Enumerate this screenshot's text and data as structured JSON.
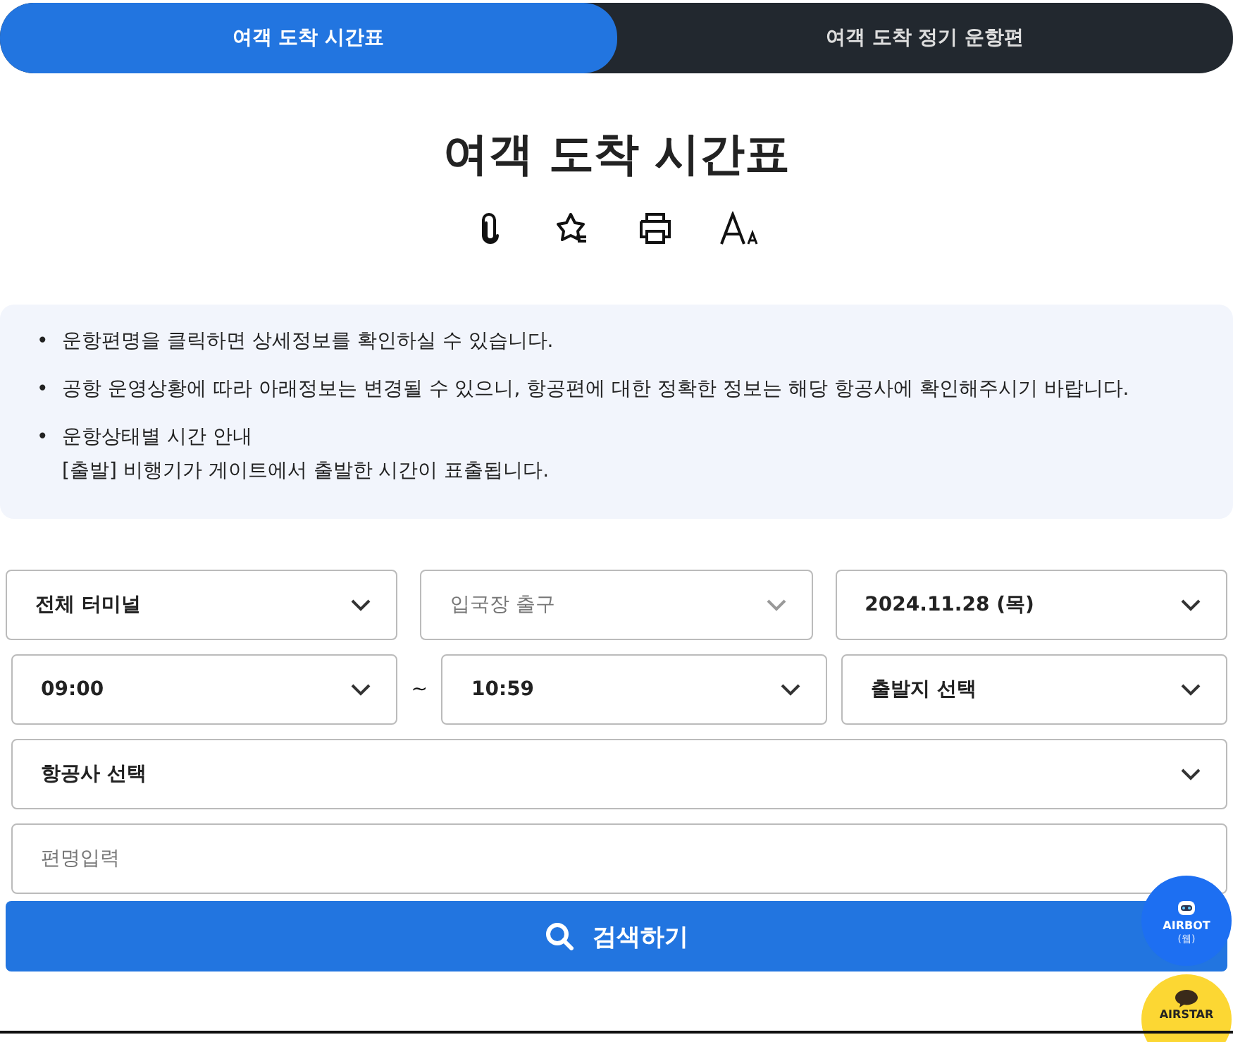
{
  "tabs": [
    {
      "label": "여객 도착 시간표",
      "selected": true
    },
    {
      "label": "여객 도착 정기 운항편",
      "selected": false
    }
  ],
  "title": "여객 도착 시간표",
  "notices": [
    {
      "bullet": "•",
      "lines": [
        "운항편명을 클릭하면 상세정보를 확인하실 수 있습니다."
      ]
    },
    {
      "bullet": "•",
      "lines": [
        "공항 운영상황에 따라 아래정보는 변경될 수 있으니, 항공편에 대한 정확한 정보는 해당 항공사에 확인해주시기 바랍니다."
      ]
    },
    {
      "bullet": "•",
      "lines": [
        "운항상태별 시간 안내",
        "[출발] 비행기가 게이트에서 출발한 시간이 표출됩니다."
      ]
    }
  ],
  "filter_rows": [
    [
      {
        "kind": "select",
        "value": "전체 터미널",
        "disabled": false
      },
      {
        "kind": "select",
        "value": "입국장 출구",
        "disabled": true
      },
      {
        "kind": "select",
        "value": "2024.11.28 (목)",
        "disabled": false
      }
    ],
    [
      {
        "kind": "select",
        "value": "09:00",
        "disabled": false
      },
      {
        "kind": "separator",
        "value": "~"
      },
      {
        "kind": "select",
        "value": "10:59",
        "disabled": false
      },
      {
        "kind": "select",
        "value": "출발지 선택",
        "disabled": false
      }
    ],
    [
      {
        "kind": "select",
        "value": "항공사 선택",
        "disabled": false
      }
    ]
  ],
  "flight_input": {
    "placeholder": "편명입력"
  },
  "search_button": "검색하기",
  "floating_buttons": [
    {
      "kind": "bot",
      "label": "AIRBOT",
      "sub": "(웹)"
    },
    {
      "kind": "talk",
      "label": "AIRSTAR"
    }
  ]
}
